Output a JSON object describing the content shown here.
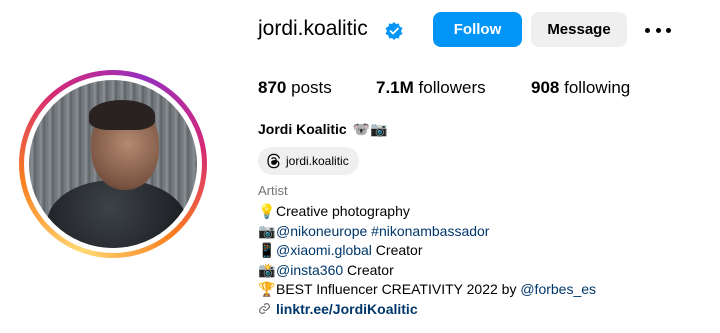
{
  "profile": {
    "username": "jordi.koalitic",
    "verified": true,
    "accent_color": "#0095f6",
    "follow_label": "Follow",
    "message_label": "Message",
    "stats": {
      "posts_value": "870",
      "posts_label": "posts",
      "followers_value": "7.1M",
      "followers_label": "followers",
      "following_value": "908",
      "following_label": "following"
    },
    "full_name": "Jordi Koalitic",
    "name_emoji": "🐨📷",
    "threads_handle": "jordi.koalitic",
    "category": "Artist",
    "bio": {
      "line1_icon": "💡",
      "line1_text": "Creative photography",
      "line2_icon": "📷",
      "line2_mention": "@nikoneurope #nikonambassador",
      "line3_icon": "📱",
      "line3_mention": "@xiaomi.global",
      "line3_text": " Creator",
      "line4_icon": "📸",
      "line4_mention": "@insta360",
      "line4_text": " Creator",
      "line5_icon": "🏆",
      "line5_text": "BEST Influencer CREATIVITY 2022 by ",
      "line5_mention": "@forbes_es"
    },
    "link": "linktr.ee/JordiKoalitic"
  }
}
